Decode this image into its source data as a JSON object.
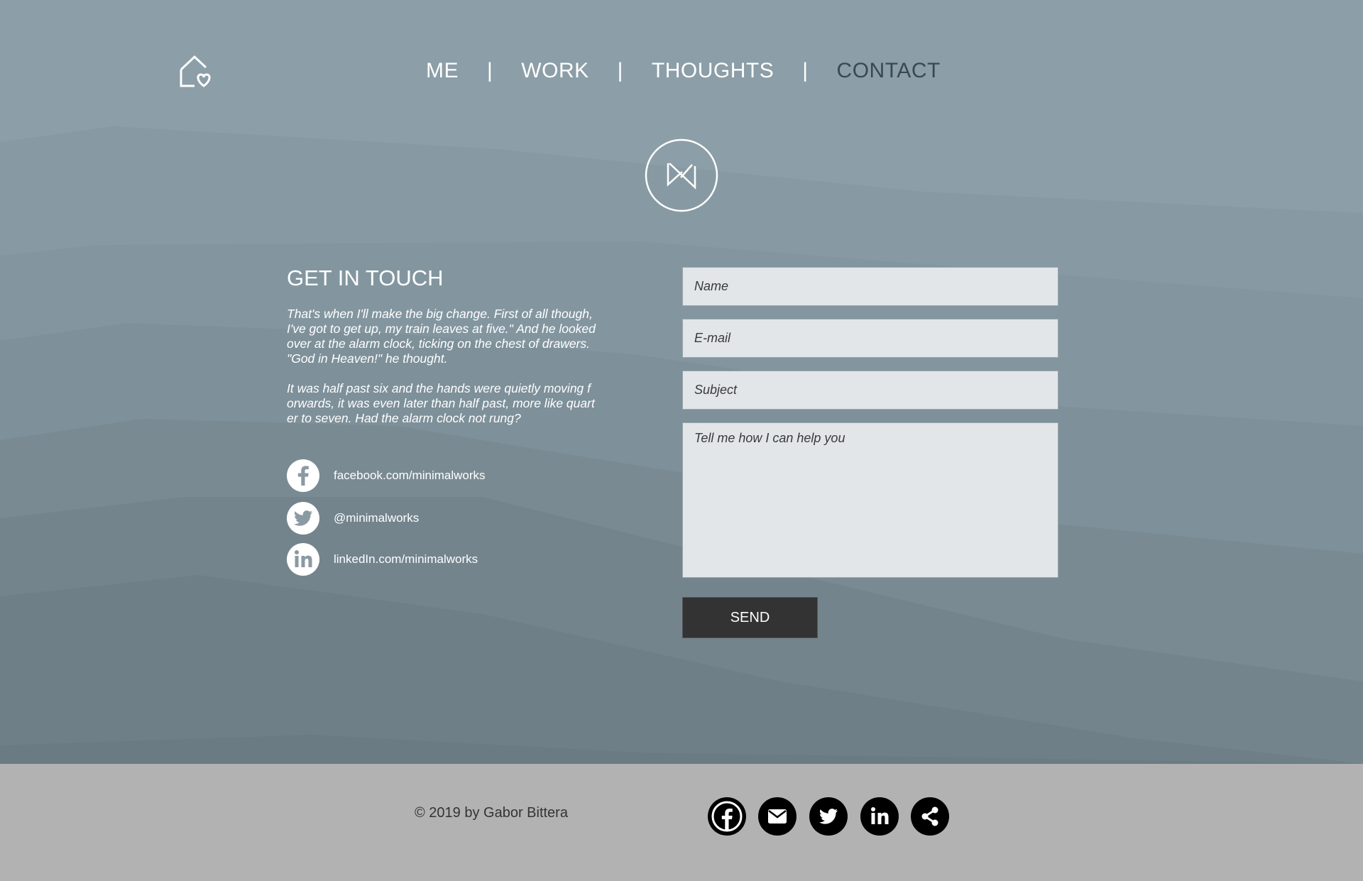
{
  "nav": {
    "home_icon": "home-heart-icon",
    "items": [
      {
        "label": "ME"
      },
      {
        "label": "WORK"
      },
      {
        "label": "THOUGHTS"
      },
      {
        "label": "CONTACT",
        "active": true
      }
    ],
    "separator": "|"
  },
  "logo": {
    "icon": "nw-monogram-logo"
  },
  "contact": {
    "title": "GET IN TOUCH",
    "paragraph1": "That's when I'll make the big change. First of all though,\nI've got to get up, my train leaves at five.\" And he looked\n over at the alarm clock, ticking on the chest of drawers.\n \"God in Heaven!\" he thought.",
    "paragraph2": "It was half past six and the hands were quietly moving f\norwards, it was even later than half past, more like quart\ner to seven. Had the alarm clock not rung?",
    "social": [
      {
        "icon": "facebook-icon",
        "label": "facebook.com/minimalworks"
      },
      {
        "icon": "twitter-icon",
        "label": "@minimalworks"
      },
      {
        "icon": "linkedin-icon",
        "label": "linkedIn.com/minimalworks"
      }
    ]
  },
  "form": {
    "name_placeholder": "Name",
    "email_placeholder": "E-mail",
    "subject_placeholder": "Subject",
    "message_placeholder": "Tell me how I can help you",
    "send_label": "SEND"
  },
  "footer": {
    "copyright": "© 2019 by Gabor Bittera",
    "icons": [
      "facebook-icon",
      "mail-icon",
      "twitter-icon",
      "linkedin-icon",
      "share-icon"
    ]
  },
  "colors": {
    "hero_bg": "#8c9ea7",
    "footer_bg": "#b2b2b2",
    "button_bg": "#333333",
    "active_nav": "#3a4850",
    "input_bg": "#e2e6e9"
  }
}
